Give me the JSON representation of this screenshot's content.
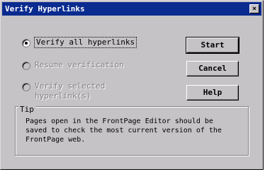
{
  "window": {
    "title": "Verify Hyperlinks",
    "close_glyph": "×"
  },
  "options": [
    {
      "label": "Verify all hyperlinks",
      "checked": true,
      "enabled": true
    },
    {
      "label": "Resume verification",
      "checked": false,
      "enabled": false
    },
    {
      "label": "Verify selected hyperlink(s)",
      "checked": false,
      "enabled": false
    }
  ],
  "buttons": {
    "start": "Start",
    "cancel": "Cancel",
    "help": "Help"
  },
  "tip": {
    "title": "Tip",
    "text": "Pages open in the FrontPage Editor should be saved to check the most current version of the FrontPage web."
  },
  "colors": {
    "titlebar": "#0a2b8f",
    "face": "#c6c3c6"
  }
}
